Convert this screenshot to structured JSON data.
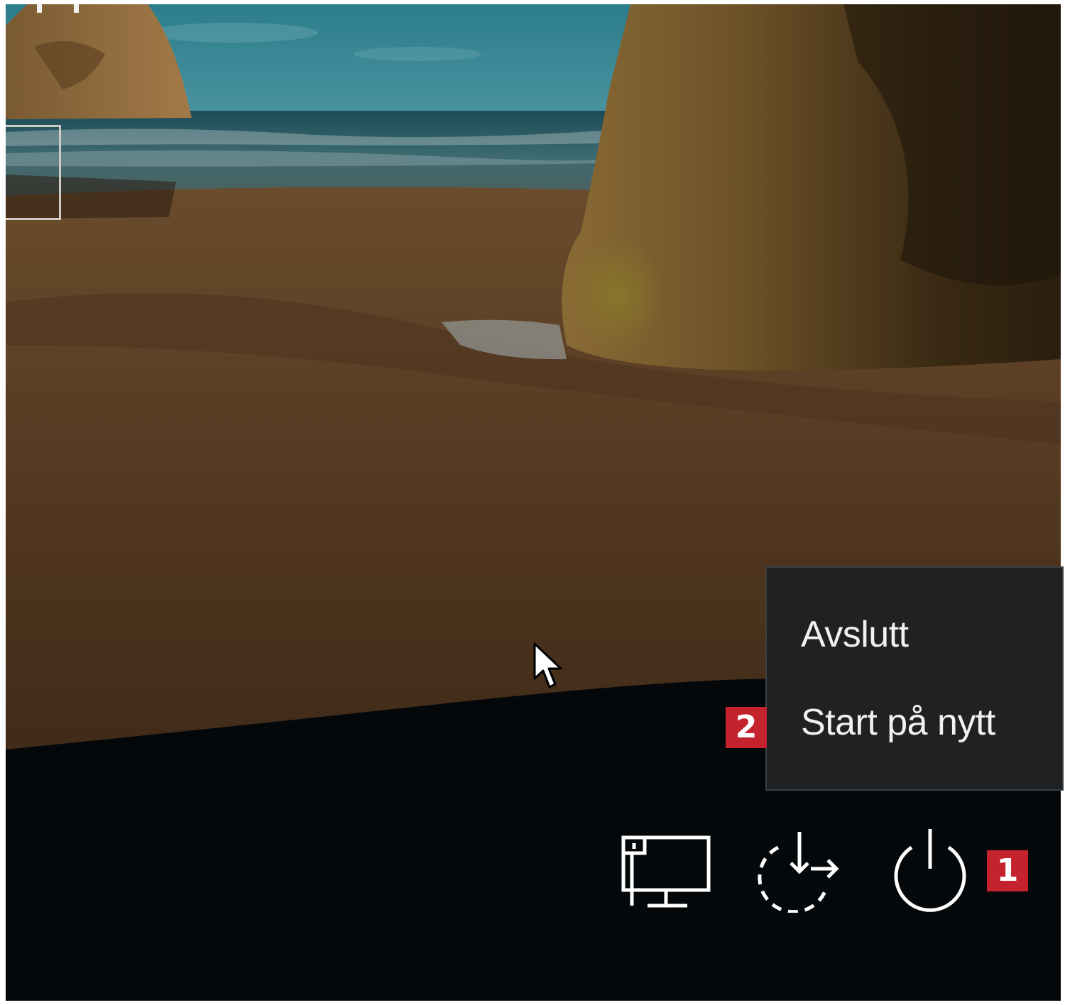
{
  "lock_screen": {
    "wallpaper": "beach-with-rocks",
    "accent_color": "#c4232e",
    "menu_background": "#1f2123"
  },
  "power_menu": {
    "items": [
      {
        "label": "Avslutt"
      },
      {
        "label": "Start på nytt"
      }
    ]
  },
  "callouts": {
    "step_1": "1",
    "step_2": "2"
  },
  "tray": {
    "icons": [
      "network-icon",
      "ease-of-access-icon",
      "power-icon"
    ]
  }
}
